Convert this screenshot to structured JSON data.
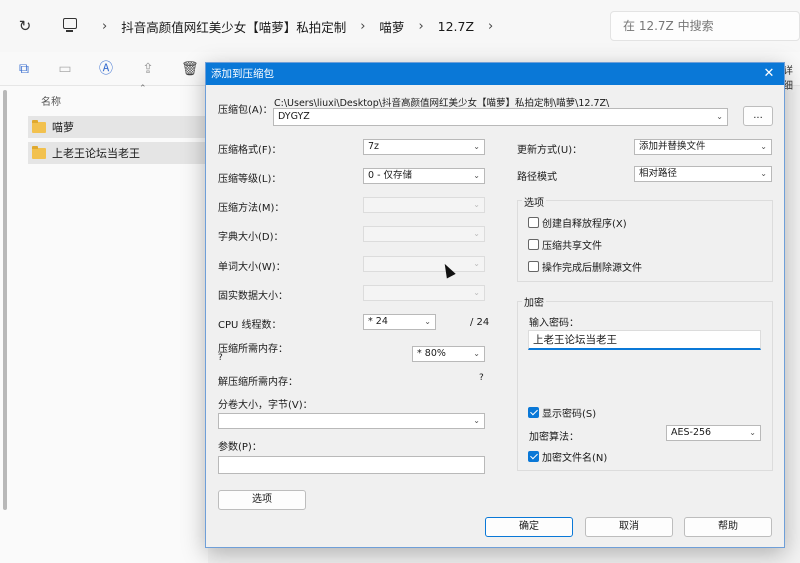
{
  "explorer": {
    "breadcrumbs": [
      "抖音高颜值网红美少女【喵萝】私拍定制",
      "喵萝",
      "12.7Z"
    ],
    "search_placeholder": "在 12.7Z 中搜索",
    "detail_label": "详细",
    "column_name": "名称",
    "files": [
      "喵萝",
      "上老王论坛当老王"
    ]
  },
  "dialog": {
    "title": "添加到压缩包",
    "archive_label": "压缩包(A)：",
    "archive_path": "C:\\Users\\liuxi\\Desktop\\抖音高颜值网红美少女【喵萝】私拍定制\\喵萝\\12.7Z\\",
    "archive_name": "DYGYZ",
    "browse_label": "...",
    "format_label": "压缩格式(F)：",
    "format_value": "7z",
    "level_label": "压缩等级(L)：",
    "level_value": "0 - 仅存储",
    "method_label": "压缩方法(M)：",
    "dict_label": "字典大小(D)：",
    "word_label": "单词大小(W)：",
    "solid_label": "固实数据大小：",
    "threads_label": "CPU 线程数：",
    "threads_value": "* 24",
    "threads_max": "/ 24",
    "mem_compress_label": "压缩所需内存：",
    "mem_compress_value": "?",
    "mem_percent": "* 80%",
    "mem_decompress_label": "解压缩所需内存：",
    "mem_decompress_value": "?",
    "split_label": "分卷大小，字节(V)：",
    "params_label": "参数(P)：",
    "options_button": "选项",
    "update_label": "更新方式(U)：",
    "update_value": "添加并替换文件",
    "path_label": "路径模式",
    "path_value": "相对路径",
    "options_group": "选项",
    "opt_sfx": "创建自释放程序(X)",
    "opt_shared": "压缩共享文件",
    "opt_delete": "操作完成后删除源文件",
    "encrypt_group": "加密",
    "password_label": "输入密码：",
    "password_value": "上老王论坛当老王",
    "show_password": "显示密码(S)",
    "enc_method_label": "加密算法：",
    "enc_method_value": "AES-256",
    "encrypt_names": "加密文件名(N)",
    "ok": "确定",
    "cancel": "取消",
    "help": "帮助"
  }
}
